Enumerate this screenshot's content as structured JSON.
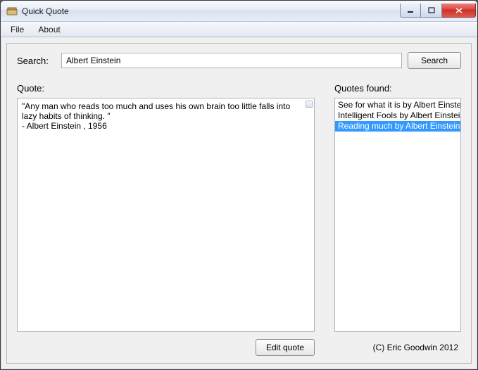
{
  "window": {
    "title": "Quick Quote"
  },
  "menubar": {
    "items": [
      "File",
      "About"
    ]
  },
  "search": {
    "label": "Search:",
    "value": "Albert Einstein",
    "button_label": "Search"
  },
  "quote_panel": {
    "label": "Quote:",
    "text": "\"Any man who reads too much and uses his own brain too little falls into lazy habits of thinking. \"\n- Albert Einstein , 1956",
    "edit_button_label": "Edit quote"
  },
  "results_panel": {
    "label": "Quotes found:",
    "items": [
      {
        "label": "See for what it is by Albert Einstein",
        "selected": false
      },
      {
        "label": "Intelligent Fools by Albert Einstein",
        "selected": false
      },
      {
        "label": "Reading much by Albert Einstein",
        "selected": true
      }
    ]
  },
  "footer": {
    "credit": "(C) Eric Goodwin 2012"
  }
}
